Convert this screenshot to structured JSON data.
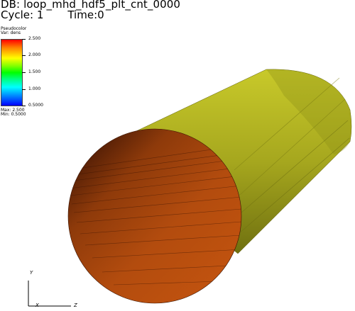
{
  "header": {
    "db": "DB: loop_mhd_hdf5_plt_cnt_0000",
    "cycle": "Cycle: 1",
    "time": "Time:0"
  },
  "legend": {
    "title_line1": "Pseudocolor",
    "title_line2": "Var: dens",
    "ticks": [
      "2.500",
      "2.000",
      "1.500",
      "1.000",
      "0.5000"
    ],
    "max_label": "Max: 2.500",
    "min_label": "Min: 0.5000"
  },
  "axes": {
    "y": "Y",
    "x": "X",
    "z": "Z"
  },
  "colors": {
    "cylinder_side": "#a3a41e",
    "cylinder_cap": "#b04a0c"
  }
}
